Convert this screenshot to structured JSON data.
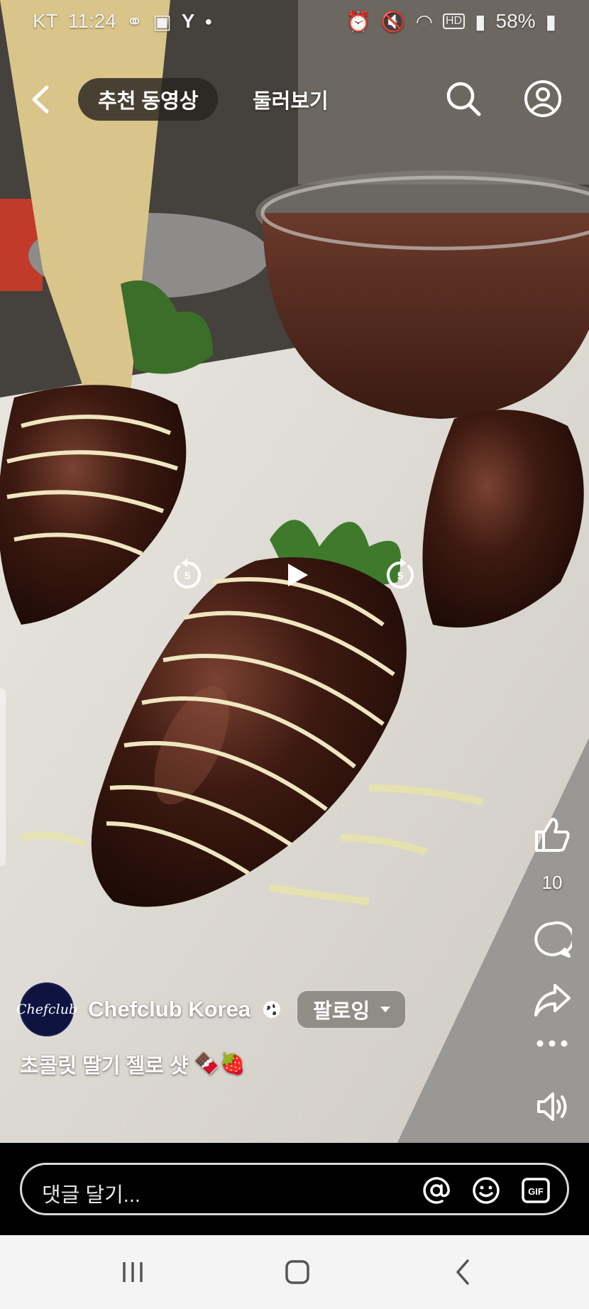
{
  "status_bar": {
    "carrier": "KT",
    "time": "11:24",
    "battery": "58%"
  },
  "top_nav": {
    "tabs": [
      {
        "label": "추천 동영상",
        "active": true
      },
      {
        "label": "둘러보기",
        "active": false
      }
    ]
  },
  "video": {
    "playback": {
      "rewind_seconds": "5",
      "forward_seconds": "5"
    }
  },
  "actions": {
    "like_count": "10"
  },
  "author": {
    "avatar_text": "Chefclub",
    "name": "Chefclub Korea",
    "follow_label": "팔로잉"
  },
  "caption": {
    "text": "초콜릿 딸기 젤로 샷",
    "emojis": "🍫🍓"
  },
  "comment_bar": {
    "placeholder": "댓글 달기...",
    "gif_label": "GIF"
  },
  "colors": {
    "chocolate": "#3a1a12",
    "tab_bg": "#2a2420",
    "nav_bar_bg": "#f4f4f4",
    "avatar_bg": "#0e1340"
  }
}
